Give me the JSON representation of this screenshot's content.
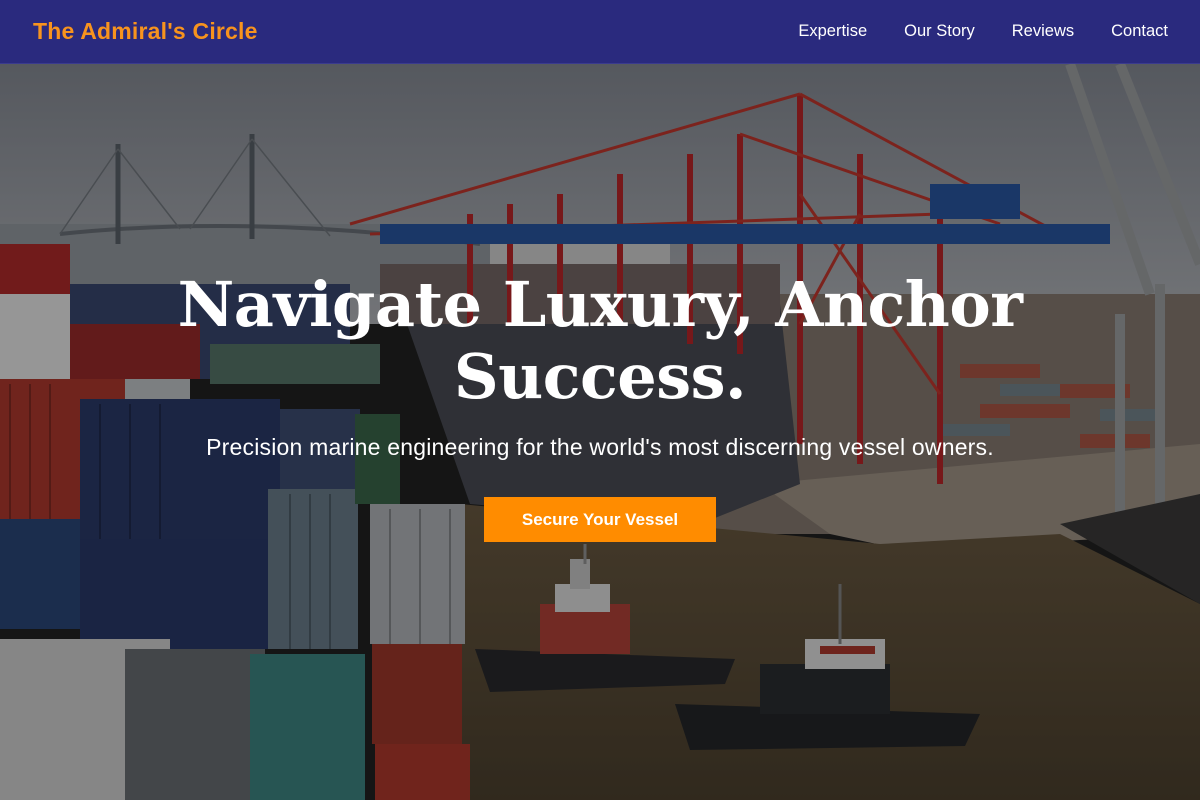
{
  "nav": {
    "brand": "The Admiral's Circle",
    "links": [
      "Expertise",
      "Our Story",
      "Reviews",
      "Contact"
    ]
  },
  "hero": {
    "title": "Navigate Luxury, Anchor Success.",
    "subtitle": "Precision marine engineering for the world's most discerning vessel owners.",
    "cta_label": "Secure Your Vessel"
  },
  "colors": {
    "nav_background": "#2a2a7e",
    "brand": "#f7931e",
    "cta": "#ff8c00"
  }
}
